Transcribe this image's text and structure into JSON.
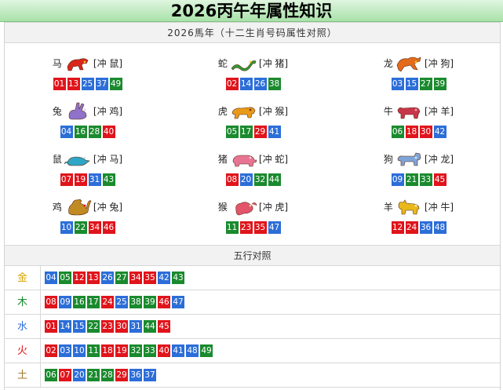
{
  "title": "2026丙午年属性知识",
  "section1_heading": "2026馬年（十二生肖号码属性对照）",
  "section2_heading": "五行对照",
  "colors": {
    "red": "#e0141b",
    "blue": "#2c6ed8",
    "green": "#1a8a2e"
  },
  "zodiacs": [
    {
      "animal": "马",
      "icon": "horse-icon",
      "clash": "[冲 鼠]",
      "numbers": [
        "01",
        "13",
        "25",
        "37",
        "49"
      ],
      "colors": [
        "r",
        "r",
        "b",
        "b",
        "g"
      ]
    },
    {
      "animal": "蛇",
      "icon": "snake-icon",
      "clash": "[冲 猪]",
      "numbers": [
        "02",
        "14",
        "26",
        "38"
      ],
      "colors": [
        "r",
        "b",
        "b",
        "g"
      ]
    },
    {
      "animal": "龙",
      "icon": "dragon-icon",
      "clash": "[冲 狗]",
      "numbers": [
        "03",
        "15",
        "27",
        "39"
      ],
      "colors": [
        "b",
        "b",
        "g",
        "g"
      ]
    },
    {
      "animal": "兔",
      "icon": "rabbit-icon",
      "clash": "[冲 鸡]",
      "numbers": [
        "04",
        "16",
        "28",
        "40"
      ],
      "colors": [
        "b",
        "g",
        "g",
        "r"
      ]
    },
    {
      "animal": "虎",
      "icon": "tiger-icon",
      "clash": "[冲 猴]",
      "numbers": [
        "05",
        "17",
        "29",
        "41"
      ],
      "colors": [
        "g",
        "g",
        "r",
        "b"
      ]
    },
    {
      "animal": "牛",
      "icon": "ox-icon",
      "clash": "[冲 羊]",
      "numbers": [
        "06",
        "18",
        "30",
        "42"
      ],
      "colors": [
        "g",
        "r",
        "r",
        "b"
      ]
    },
    {
      "animal": "鼠",
      "icon": "rat-icon",
      "clash": "[冲 马]",
      "numbers": [
        "07",
        "19",
        "31",
        "43"
      ],
      "colors": [
        "r",
        "r",
        "b",
        "g"
      ]
    },
    {
      "animal": "猪",
      "icon": "pig-icon",
      "clash": "[冲 蛇]",
      "numbers": [
        "08",
        "20",
        "32",
        "44"
      ],
      "colors": [
        "r",
        "b",
        "g",
        "g"
      ]
    },
    {
      "animal": "狗",
      "icon": "dog-icon",
      "clash": "[冲 龙]",
      "numbers": [
        "09",
        "21",
        "33",
        "45"
      ],
      "colors": [
        "b",
        "g",
        "g",
        "r"
      ]
    },
    {
      "animal": "鸡",
      "icon": "rooster-icon",
      "clash": "[冲 兔]",
      "numbers": [
        "10",
        "22",
        "34",
        "46"
      ],
      "colors": [
        "b",
        "g",
        "r",
        "r"
      ]
    },
    {
      "animal": "猴",
      "icon": "monkey-icon",
      "clash": "[冲 虎]",
      "numbers": [
        "11",
        "23",
        "35",
        "47"
      ],
      "colors": [
        "g",
        "r",
        "r",
        "b"
      ]
    },
    {
      "animal": "羊",
      "icon": "goat-icon",
      "clash": "[冲 牛]",
      "numbers": [
        "12",
        "24",
        "36",
        "48"
      ],
      "colors": [
        "r",
        "r",
        "b",
        "b"
      ]
    }
  ],
  "wuxing": [
    {
      "element": "金",
      "color": "#d9a400",
      "numbers": [
        "04",
        "05",
        "12",
        "13",
        "26",
        "27",
        "34",
        "35",
        "42",
        "43"
      ],
      "colors": [
        "b",
        "g",
        "r",
        "r",
        "b",
        "g",
        "r",
        "r",
        "b",
        "g"
      ]
    },
    {
      "element": "木",
      "color": "#1a8a2e",
      "numbers": [
        "08",
        "09",
        "16",
        "17",
        "24",
        "25",
        "38",
        "39",
        "46",
        "47"
      ],
      "colors": [
        "r",
        "b",
        "g",
        "g",
        "r",
        "b",
        "g",
        "g",
        "r",
        "b"
      ]
    },
    {
      "element": "水",
      "color": "#2c6ed8",
      "numbers": [
        "01",
        "14",
        "15",
        "22",
        "23",
        "30",
        "31",
        "44",
        "45"
      ],
      "colors": [
        "r",
        "b",
        "b",
        "g",
        "r",
        "r",
        "b",
        "g",
        "r"
      ]
    },
    {
      "element": "火",
      "color": "#e0141b",
      "numbers": [
        "02",
        "03",
        "10",
        "11",
        "18",
        "19",
        "32",
        "33",
        "40",
        "41",
        "48",
        "49"
      ],
      "colors": [
        "r",
        "b",
        "b",
        "g",
        "r",
        "r",
        "g",
        "g",
        "r",
        "b",
        "b",
        "g"
      ]
    },
    {
      "element": "土",
      "color": "#a07a2c",
      "numbers": [
        "06",
        "07",
        "20",
        "21",
        "28",
        "29",
        "36",
        "37"
      ],
      "colors": [
        "g",
        "r",
        "b",
        "g",
        "g",
        "r",
        "b",
        "b"
      ]
    }
  ]
}
